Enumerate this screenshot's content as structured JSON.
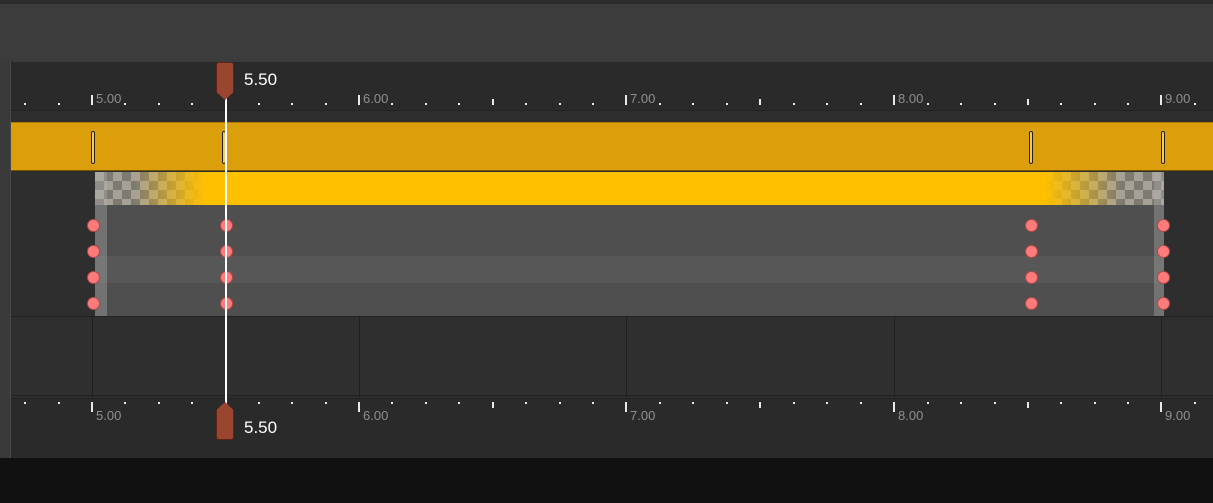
{
  "timeline": {
    "current_time": "5.50",
    "ruler_top_labels": [
      "5.00",
      "6.00",
      "7.00",
      "8.00",
      "9.00"
    ],
    "ruler_bottom_labels": [
      "5.00",
      "6.00",
      "7.00",
      "8.00",
      "9.00"
    ]
  },
  "colors": {
    "track_bar": "#dc9f0c",
    "clip_header": "#ffc000",
    "keyframe_dot": "#ff7a7a",
    "playhead_handle": "#9a452f"
  },
  "icons": {
    "playhead_top": "playhead-handle-icon",
    "playhead_bottom": "playhead-handle-icon",
    "keyframe": "keyframe-dot-icon"
  }
}
